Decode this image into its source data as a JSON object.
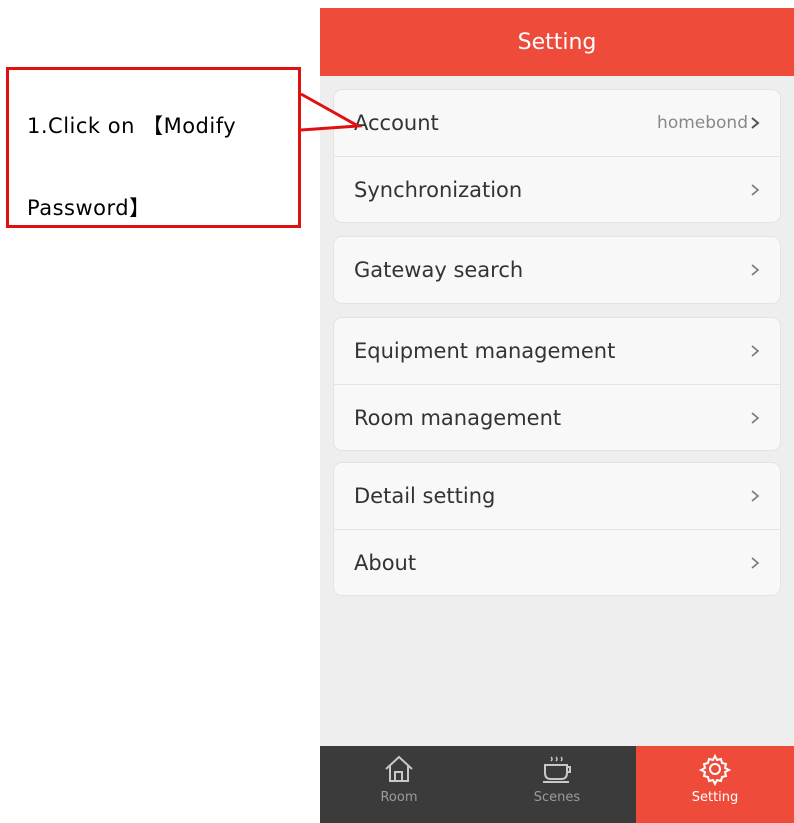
{
  "header": {
    "title": "Setting"
  },
  "groups": [
    {
      "items": [
        {
          "label": "Account",
          "value": "homebond"
        },
        {
          "label": "Synchronization",
          "value": ""
        }
      ]
    },
    {
      "items": [
        {
          "label": "Gateway search",
          "value": ""
        }
      ]
    },
    {
      "items": [
        {
          "label": "Equipment management",
          "value": ""
        },
        {
          "label": "Room management",
          "value": ""
        }
      ]
    },
    {
      "items": [
        {
          "label": "Detail setting",
          "value": ""
        },
        {
          "label": "About",
          "value": ""
        }
      ]
    }
  ],
  "tabbar": {
    "tabs": [
      {
        "label": "Room",
        "icon": "house-icon",
        "active": false
      },
      {
        "label": "Scenes",
        "icon": "coffee-cup-icon",
        "active": false
      },
      {
        "label": "Setting",
        "icon": "gear-icon",
        "active": true
      }
    ]
  },
  "annotation": {
    "line1": "1.Click on 【Modify",
    "line2": "Password】"
  },
  "colors": {
    "accent": "#ee4b3b",
    "tabbar_bg": "#3b3b3b",
    "annotation": "#e01010",
    "panel_bg": "#eeeeee"
  }
}
